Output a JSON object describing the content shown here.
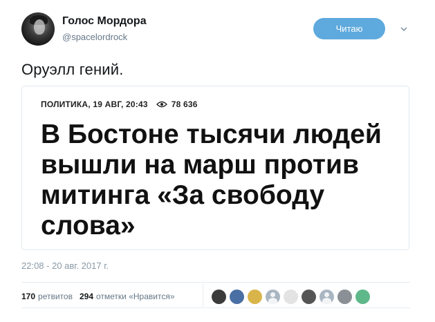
{
  "author": {
    "name": "Голос Мордора",
    "handle": "@spacelordrock"
  },
  "follow_button": {
    "label": "Читаю",
    "color": "#5ea9dd"
  },
  "tweet": {
    "text": "Оруэлл гений.",
    "timestamp": "22:08 - 20 авг. 2017 г."
  },
  "card": {
    "meta": "ПОЛИТИКА, 19 АВГ, 20:43",
    "views": "78 636",
    "headline_lines": [
      "В Бостоне тысячи людей",
      "вышли на марш против",
      "митинга «За свободу",
      "слова»"
    ]
  },
  "stats": {
    "retweets_count": "170",
    "retweets_label": "ретвитов",
    "likes_count": "294",
    "likes_label": "отметки «Нравится»"
  },
  "likers": [
    {
      "icon": "avatar-dark",
      "color": "#3b3b3b"
    },
    {
      "icon": "avatar-blue",
      "color": "#4a6fa5"
    },
    {
      "icon": "avatar-yellow",
      "color": "#d9b44a"
    },
    {
      "icon": "avatar-default",
      "color": "#a9b6c2"
    },
    {
      "icon": "avatar-sketch",
      "color": "#e3e3e3"
    },
    {
      "icon": "avatar-bw",
      "color": "#555555"
    },
    {
      "icon": "avatar-default",
      "color": "#a9b6c2"
    },
    {
      "icon": "avatar-plane",
      "color": "#8a9096"
    },
    {
      "icon": "avatar-green",
      "color": "#5fb88a"
    }
  ]
}
